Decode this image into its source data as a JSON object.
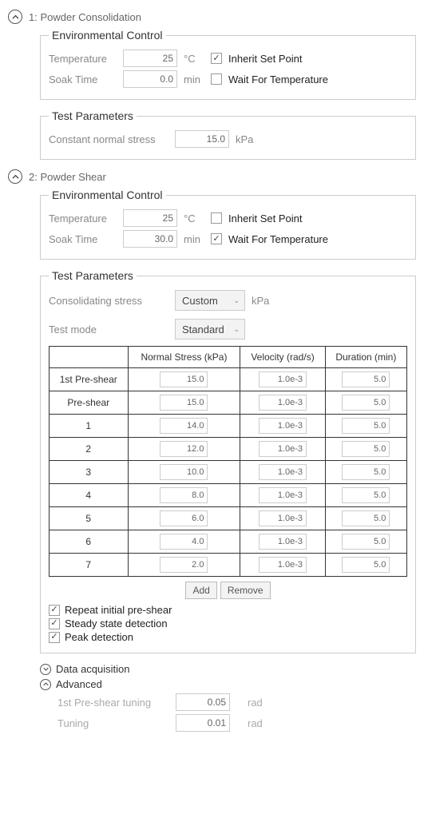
{
  "step1": {
    "title": "1: Powder Consolidation",
    "env": {
      "legend": "Environmental Control",
      "temp_label": "Temperature",
      "temp_value": "25",
      "temp_unit": "°C",
      "inherit_label": "Inherit Set Point",
      "soak_label": "Soak Time",
      "soak_value": "0.0",
      "soak_unit": "min",
      "wait_label": "Wait For Temperature"
    },
    "test": {
      "legend": "Test Parameters",
      "cns_label": "Constant normal stress",
      "cns_value": "15.0",
      "cns_unit": "kPa"
    }
  },
  "step2": {
    "title": "2: Powder Shear",
    "env": {
      "legend": "Environmental Control",
      "temp_label": "Temperature",
      "temp_value": "25",
      "temp_unit": "°C",
      "inherit_label": "Inherit Set Point",
      "soak_label": "Soak Time",
      "soak_value": "30.0",
      "soak_unit": "min",
      "wait_label": "Wait For Temperature"
    },
    "test": {
      "legend": "Test Parameters",
      "cons_label": "Consolidating stress",
      "cons_value": "Custom",
      "cons_unit": "kPa",
      "mode_label": "Test mode",
      "mode_value": "Standard",
      "table": {
        "h1": "Normal Stress (kPa)",
        "h2": "Velocity (rad/s)",
        "h3": "Duration (min)",
        "rows": [
          {
            "label": "1st Pre-shear",
            "ns": "15.0",
            "v": "1.0e-3",
            "d": "5.0"
          },
          {
            "label": "Pre-shear",
            "ns": "15.0",
            "v": "1.0e-3",
            "d": "5.0"
          },
          {
            "label": "1",
            "ns": "14.0",
            "v": "1.0e-3",
            "d": "5.0"
          },
          {
            "label": "2",
            "ns": "12.0",
            "v": "1.0e-3",
            "d": "5.0"
          },
          {
            "label": "3",
            "ns": "10.0",
            "v": "1.0e-3",
            "d": "5.0"
          },
          {
            "label": "4",
            "ns": "8.0",
            "v": "1.0e-3",
            "d": "5.0"
          },
          {
            "label": "5",
            "ns": "6.0",
            "v": "1.0e-3",
            "d": "5.0"
          },
          {
            "label": "6",
            "ns": "4.0",
            "v": "1.0e-3",
            "d": "5.0"
          },
          {
            "label": "7",
            "ns": "2.0",
            "v": "1.0e-3",
            "d": "5.0"
          }
        ]
      },
      "add_btn": "Add",
      "remove_btn": "Remove",
      "repeat_label": "Repeat initial pre-shear",
      "steady_label": "Steady state detection",
      "peak_label": "Peak detection"
    },
    "data_acq": {
      "title": "Data acquisition"
    },
    "advanced": {
      "title": "Advanced",
      "t1_label": "1st Pre-shear tuning",
      "t1_value": "0.05",
      "t1_unit": "rad",
      "t2_label": "Tuning",
      "t2_value": "0.01",
      "t2_unit": "rad"
    }
  }
}
